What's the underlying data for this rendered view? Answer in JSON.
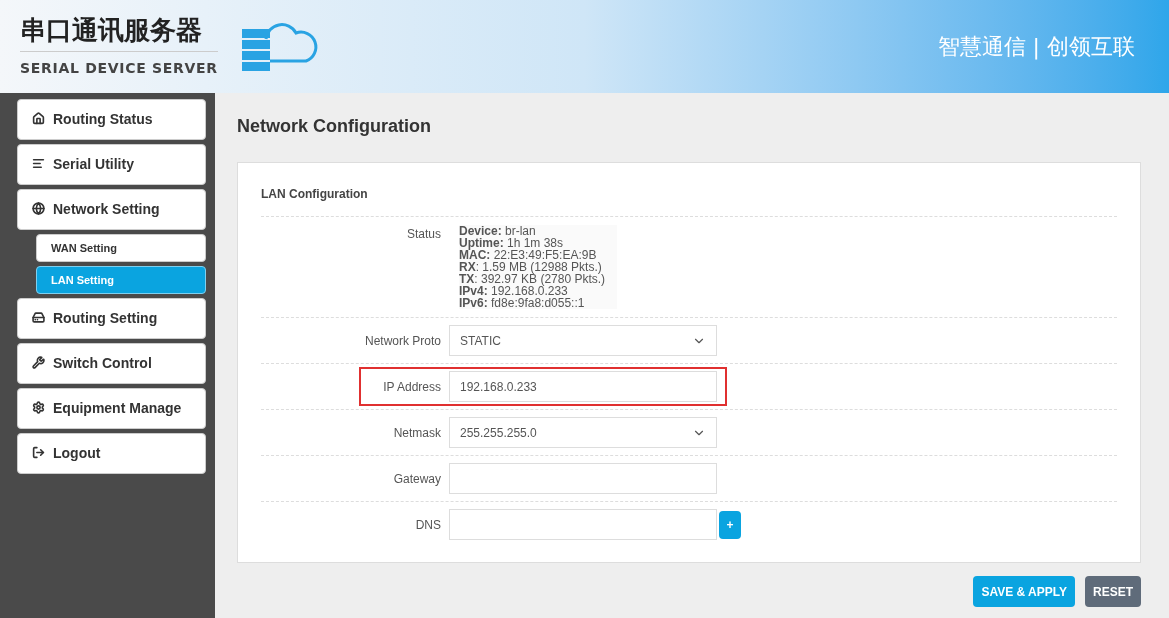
{
  "header": {
    "title": "串口通讯服务器",
    "subtitle": "SERIAL DEVICE SERVER",
    "slogan": "智慧通信 | 创领互联"
  },
  "sidebar": {
    "items": [
      {
        "label": "Routing Status",
        "selected": false
      },
      {
        "label": "Serial Utility",
        "selected": false
      },
      {
        "label": "Network Setting",
        "selected": false,
        "children": [
          {
            "label": "WAN Setting",
            "selected": false
          },
          {
            "label": "LAN Setting",
            "selected": true
          }
        ]
      },
      {
        "label": "Routing Setting",
        "selected": false
      },
      {
        "label": "Switch Control",
        "selected": false
      },
      {
        "label": "Equipment Manage",
        "selected": false
      },
      {
        "label": "Logout",
        "selected": false
      }
    ]
  },
  "page_title": "Network Configuration",
  "section": {
    "title": "LAN Configuration",
    "status": {
      "label": "Status",
      "lines": [
        "**Device:** br-lan",
        "**Uptime:** 1h 1m 38s",
        "**MAC:** 22:E3:49:F5:EA:9B",
        "**RX**: 1.59 MB (12988 Pkts.)",
        "**TX**: 392.97 KB (2780 Pkts.)",
        "**IPv4:** 192.168.0.233",
        "**IPv6:** fd8e:9fa8:d055::1"
      ]
    },
    "fields": [
      {
        "kind": "select",
        "label": "Network Proto",
        "value": "STATIC",
        "highlighted": false
      },
      {
        "kind": "input",
        "label": "IP Address",
        "value": "192.168.0.233",
        "highlighted": true
      },
      {
        "kind": "select",
        "label": "Netmask",
        "value": "255.255.255.0",
        "highlighted": false
      },
      {
        "kind": "input",
        "label": "Gateway",
        "highlighted": false
      },
      {
        "kind": "input_add",
        "label": "DNS",
        "add": "+",
        "highlighted": false
      }
    ]
  },
  "buttons": [
    {
      "label": "SAVE & APPLY",
      "kind": "primary"
    },
    {
      "label": "RESET",
      "kind": "secondary"
    }
  ]
}
